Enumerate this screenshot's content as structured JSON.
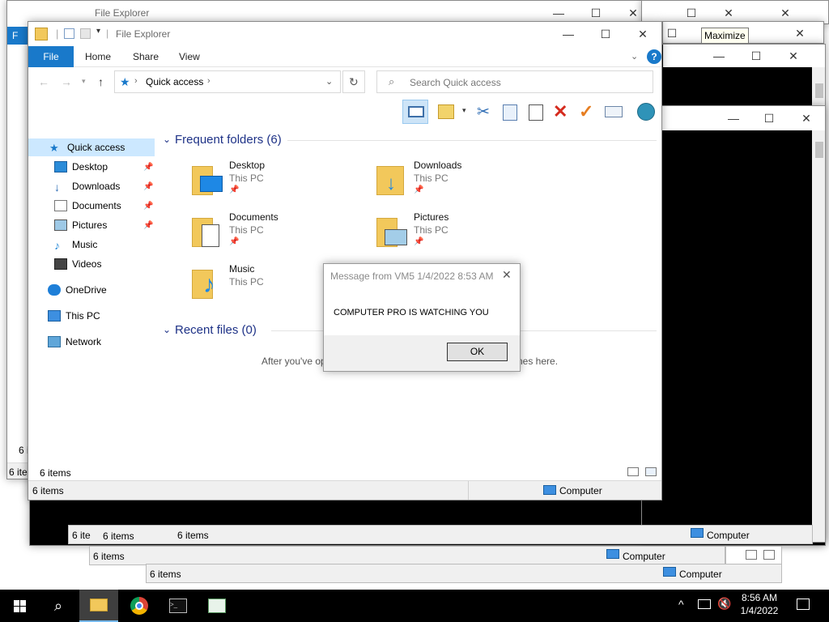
{
  "background_windows": {
    "title": "File Explorer",
    "file_tab": "F",
    "status_items": "6 items",
    "status_items_short": "6 ite",
    "status_items_6i": "6 i",
    "computer_label": "Computer",
    "tooltip": "Maximize"
  },
  "explorer": {
    "title": "File Explorer",
    "tabs": {
      "file": "File",
      "home": "Home",
      "share": "Share",
      "view": "View"
    },
    "address": {
      "location": "Quick access"
    },
    "search": {
      "placeholder": "Search Quick access"
    },
    "nav": {
      "quick_access": "Quick access",
      "desktop": "Desktop",
      "downloads": "Downloads",
      "documents": "Documents",
      "pictures": "Pictures",
      "music": "Music",
      "videos": "Videos",
      "onedrive": "OneDrive",
      "this_pc": "This PC",
      "network": "Network"
    },
    "frequent_header": "Frequent folders (6)",
    "recent_header": "Recent files (0)",
    "recent_empty_left": "After you've op",
    "recent_empty_right": "nes here.",
    "folders": [
      {
        "name": "Desktop",
        "location": "This PC"
      },
      {
        "name": "Downloads",
        "location": "This PC"
      },
      {
        "name": "Documents",
        "location": "This PC"
      },
      {
        "name": "Pictures",
        "location": "This PC"
      },
      {
        "name": "Music",
        "location": "This PC"
      }
    ],
    "inner_status": "6 items",
    "status": "6 items",
    "status_right": "Computer"
  },
  "dialog": {
    "title": "Message from VM5 1/4/2022 8:53 AM",
    "message": "COMPUTER PRO IS WATCHING YOU",
    "ok": "OK"
  },
  "taskbar": {
    "time": "8:56 AM",
    "date": "1/4/2022"
  },
  "colors": {
    "accent": "#1979ca",
    "folder": "#f2c85b",
    "taskbar": "#000000"
  }
}
